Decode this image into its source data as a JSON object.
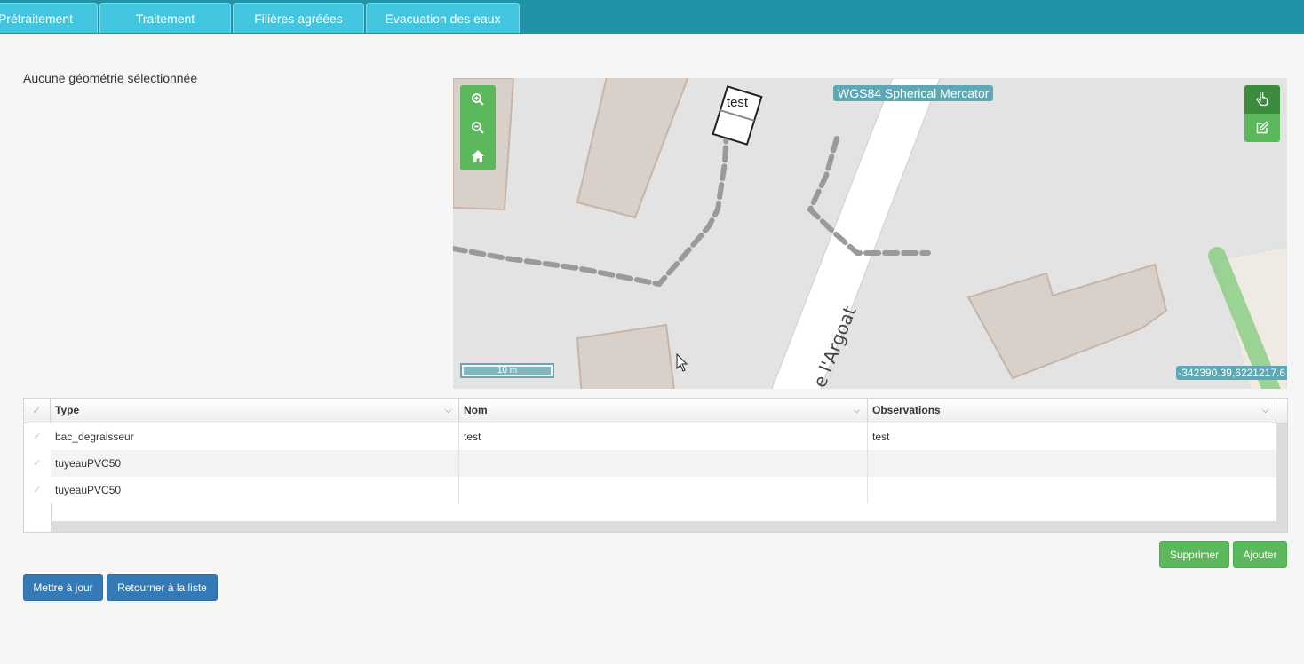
{
  "tabs": [
    {
      "label": "Prétraitement"
    },
    {
      "label": "Traitement"
    },
    {
      "label": "Filières agréées"
    },
    {
      "label": "Evacuation des eaux"
    }
  ],
  "geometry_status": "Aucune géométrie sélectionnée",
  "map": {
    "projection": "WGS84 Spherical Mercator",
    "scale_label": "10 m",
    "coordinates": "-342390.39,6221217.6",
    "feature_label": "test",
    "street_label": "e l'Argoat",
    "controls": {
      "zoom_in": "zoom-in-icon",
      "zoom_out": "zoom-out-icon",
      "home": "home-icon",
      "select": "hand-pointer-icon",
      "edit": "edit-icon"
    }
  },
  "grid": {
    "columns": [
      {
        "label": "Type"
      },
      {
        "label": "Nom"
      },
      {
        "label": "Observations"
      }
    ],
    "rows": [
      {
        "type": "bac_degraisseur",
        "nom": "test",
        "observations": "test"
      },
      {
        "type": "tuyeauPVC50",
        "nom": "",
        "observations": ""
      },
      {
        "type": "tuyeauPVC50",
        "nom": "",
        "observations": ""
      }
    ]
  },
  "actions": {
    "delete": "Supprimer",
    "add": "Ajouter",
    "update": "Mettre à jour",
    "back": "Retourner à la liste"
  },
  "colors": {
    "topbar": "#2093a6",
    "tab": "#42c6e0",
    "map_button": "#5cb85c",
    "primary_button": "#337ab7"
  }
}
